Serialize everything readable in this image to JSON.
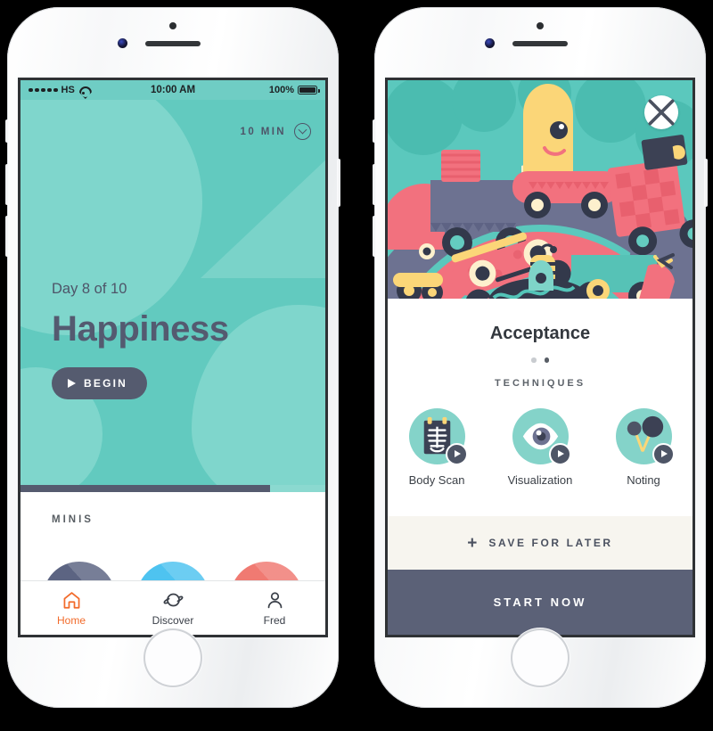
{
  "colors": {
    "teal": "#62cabf",
    "teal_light": "#7fd6cc",
    "slate": "#555b6f",
    "slate_dark": "#4e5466",
    "accent_orange": "#f26b2b",
    "coral": "#f07a72",
    "sky": "#4ec3f0",
    "indigo": "#5c6482",
    "cream": "#f7f5ef"
  },
  "left_phone": {
    "status_bar": {
      "carrier": "HS",
      "signal_dots": 5,
      "wifi_icon": "wifi-icon",
      "time": "10:00 AM",
      "battery_percent": "100%",
      "battery_icon": "battery-full-icon"
    },
    "hero": {
      "duration_label": "10 MIN",
      "duration_icon": "chevron-down-circle-icon",
      "day_label": "Day 8 of 10",
      "title": "Happiness",
      "begin_label": "BEGIN",
      "begin_icon": "play-icon",
      "progress_percent": 82
    },
    "minis": {
      "section_label": "MINIS",
      "items": [
        {
          "name": "mini-card-1",
          "color": "#5c6482"
        },
        {
          "name": "mini-card-2",
          "color": "#4ec3f0"
        },
        {
          "name": "mini-card-3",
          "color": "#f07a72"
        }
      ]
    },
    "tabbar": {
      "tabs": [
        {
          "label": "Home",
          "icon": "home-icon",
          "active": true
        },
        {
          "label": "Discover",
          "icon": "planet-icon",
          "active": false
        },
        {
          "label": "Fred",
          "icon": "person-icon",
          "active": false
        }
      ]
    }
  },
  "right_phone": {
    "illustration": {
      "name": "traffic-monsters-illustration",
      "close_icon": "close-icon"
    },
    "panel": {
      "title": "Acceptance",
      "page_dots": {
        "count": 2,
        "active_index": 1
      },
      "techniques_label": "TECHNIQUES",
      "techniques": [
        {
          "label": "Body Scan",
          "icon": "xray-ribcage-icon",
          "play_icon": "play-icon"
        },
        {
          "label": "Visualization",
          "icon": "eye-icon",
          "play_icon": "play-icon"
        },
        {
          "label": "Noting",
          "icon": "pins-icon",
          "play_icon": "play-icon"
        }
      ]
    },
    "save_label": "SAVE FOR LATER",
    "save_icon": "plus-icon",
    "start_label": "START NOW"
  }
}
